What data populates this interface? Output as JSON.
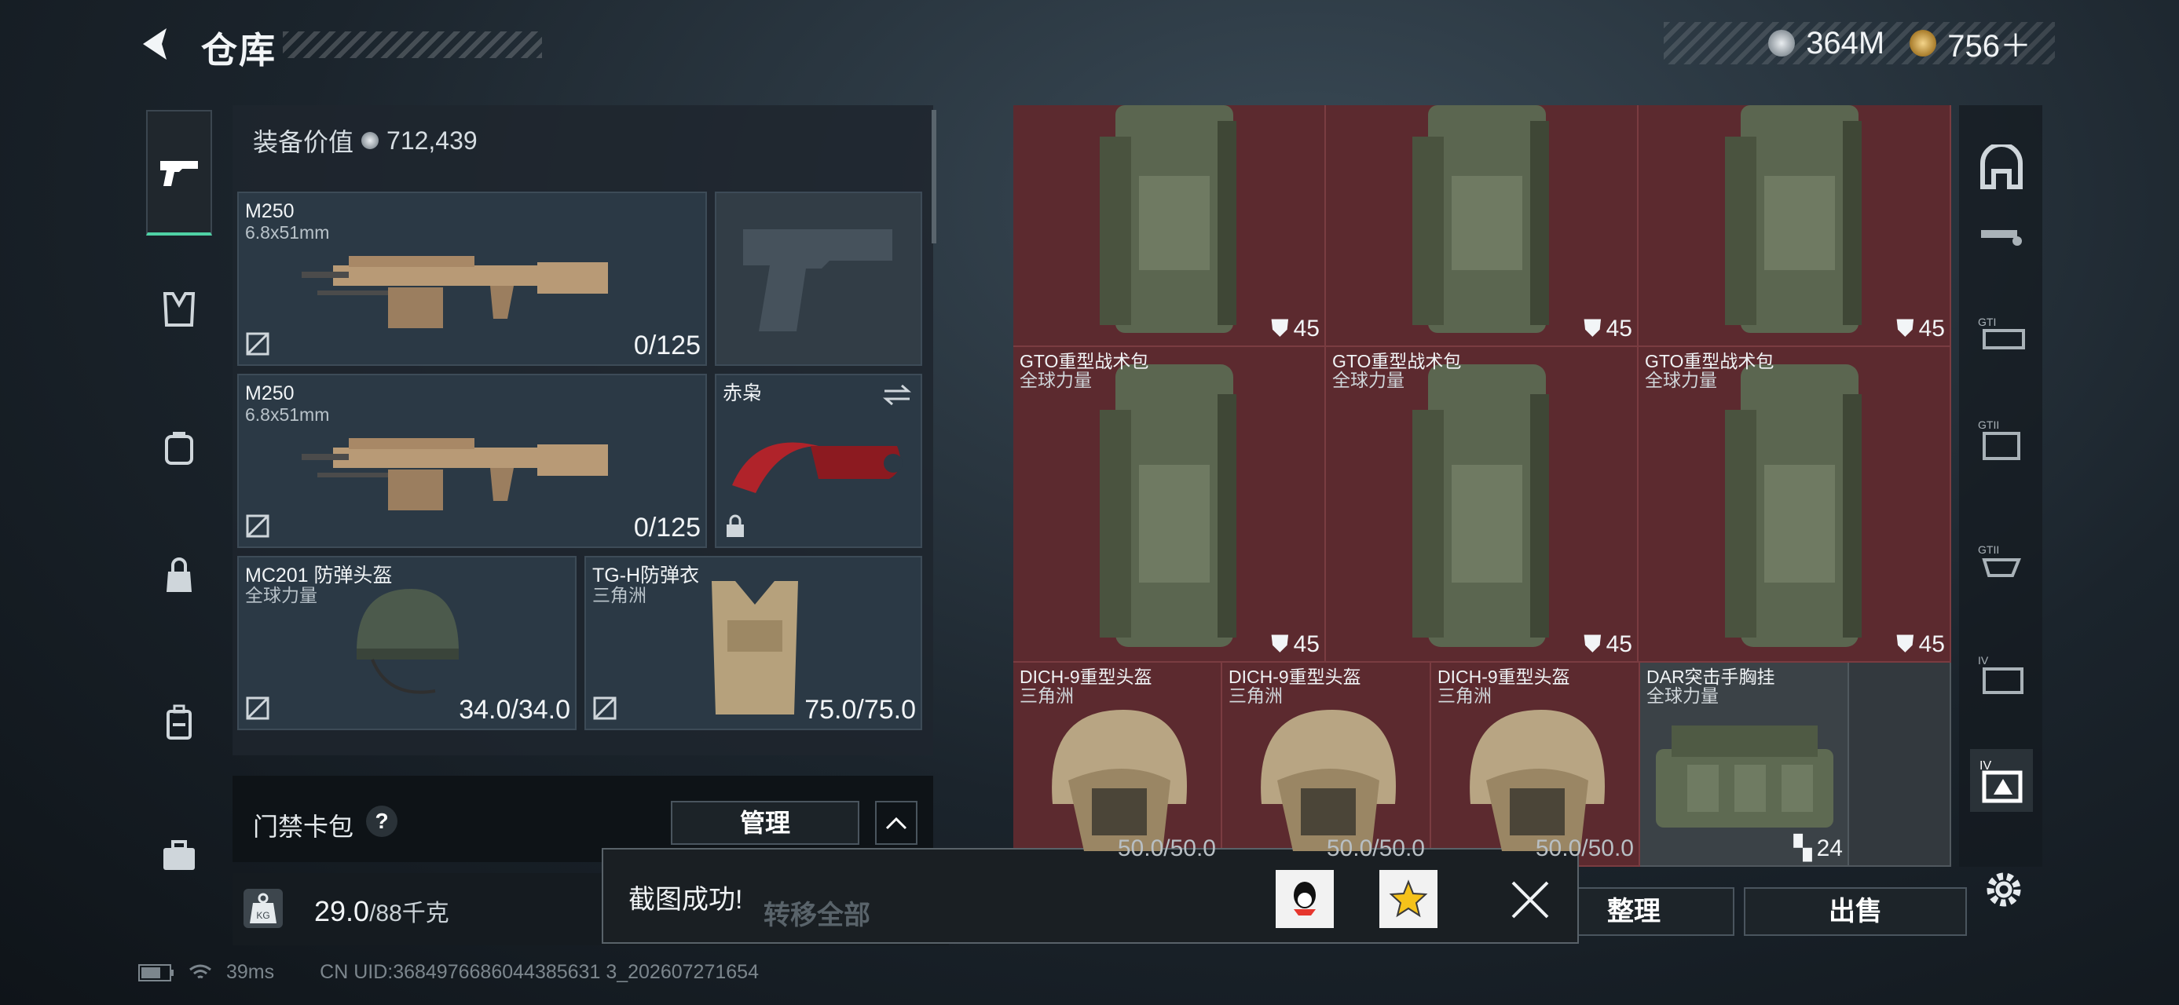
{
  "header": {
    "back_icon": "back-arrow-icon",
    "title": "仓库",
    "currencies": [
      {
        "icon": "silver-coin-icon",
        "value": "364M"
      },
      {
        "icon": "gold-coin-icon",
        "value": "756＋"
      }
    ]
  },
  "left_nav": [
    {
      "icon": "pistol-icon",
      "active": true
    },
    {
      "icon": "vest-icon",
      "active": false
    },
    {
      "icon": "backpack-icon",
      "active": false
    },
    {
      "icon": "bag-icon",
      "active": false
    },
    {
      "icon": "luggage-icon",
      "active": false
    },
    {
      "icon": "briefcase-icon",
      "active": false
    }
  ],
  "loadout": {
    "value_label": "装备价值",
    "value": "712,439",
    "slots": {
      "primary1": {
        "name": "M250",
        "ammo": "6.8x51mm",
        "count": "0/125"
      },
      "pistol": {
        "name": "",
        "placeholder_icon": "pistol-placeholder-icon"
      },
      "primary2": {
        "name": "M250",
        "ammo": "6.8x51mm",
        "count": "0/125"
      },
      "melee": {
        "name": "赤枭"
      },
      "helmet": {
        "name": "MC201 防弹头盔",
        "sub": "全球力量",
        "count": "34.0/34.0"
      },
      "armor": {
        "name": "TG-H防弹衣",
        "sub": "三角洲",
        "count": "75.0/75.0"
      }
    }
  },
  "gate": {
    "label": "门禁卡包",
    "help": "?",
    "manage": "管理"
  },
  "weight": {
    "icon_text": "KG",
    "current": "29.0",
    "max": "/88千克"
  },
  "stash": {
    "row1": [
      {
        "name": "",
        "sub": "",
        "count": "45"
      },
      {
        "name": "",
        "sub": "",
        "count": "45"
      },
      {
        "name": "",
        "sub": "",
        "count": "45"
      }
    ],
    "row2": [
      {
        "name": "GTO重型战术包",
        "sub": "全球力量",
        "count": "45"
      },
      {
        "name": "GTO重型战术包",
        "sub": "全球力量",
        "count": "45"
      },
      {
        "name": "GTO重型战术包",
        "sub": "全球力量",
        "count": "45"
      }
    ],
    "row3": [
      {
        "name": "DICH-9重型头盔",
        "sub": "三角洲",
        "count": "50.0/50.0"
      },
      {
        "name": "DICH-9重型头盔",
        "sub": "三角洲",
        "count": "50.0/50.0"
      },
      {
        "name": "DICH-9重型头盔",
        "sub": "三角洲",
        "count": "50.0/50.0"
      },
      {
        "name": "DAR突击手胸挂",
        "sub": "全球力量",
        "count": "24"
      }
    ]
  },
  "right_tabs": [
    "stash-tab-icon",
    "gun-filter-icon",
    "gti-filter-icon",
    "gtii-filter-icon",
    "gtii-alt-icon",
    "iv-folder-icon",
    "iv-active-icon"
  ],
  "bottom_buttons": {
    "tidy": "整理",
    "sell": "出售"
  },
  "toast": {
    "message": "截图成功!",
    "transfer_all": "转移全部",
    "share_icons": [
      "qq-icon",
      "qzone-icon"
    ],
    "close_icon": "close-icon"
  },
  "status": {
    "ping": "39ms",
    "uid": "CN UID:3684976686044385631 3_202607271654"
  },
  "colors": {
    "accent_green": "#4fd1a5",
    "stash_red": "#5c2a2f",
    "panel_dark": "#1e262e"
  }
}
